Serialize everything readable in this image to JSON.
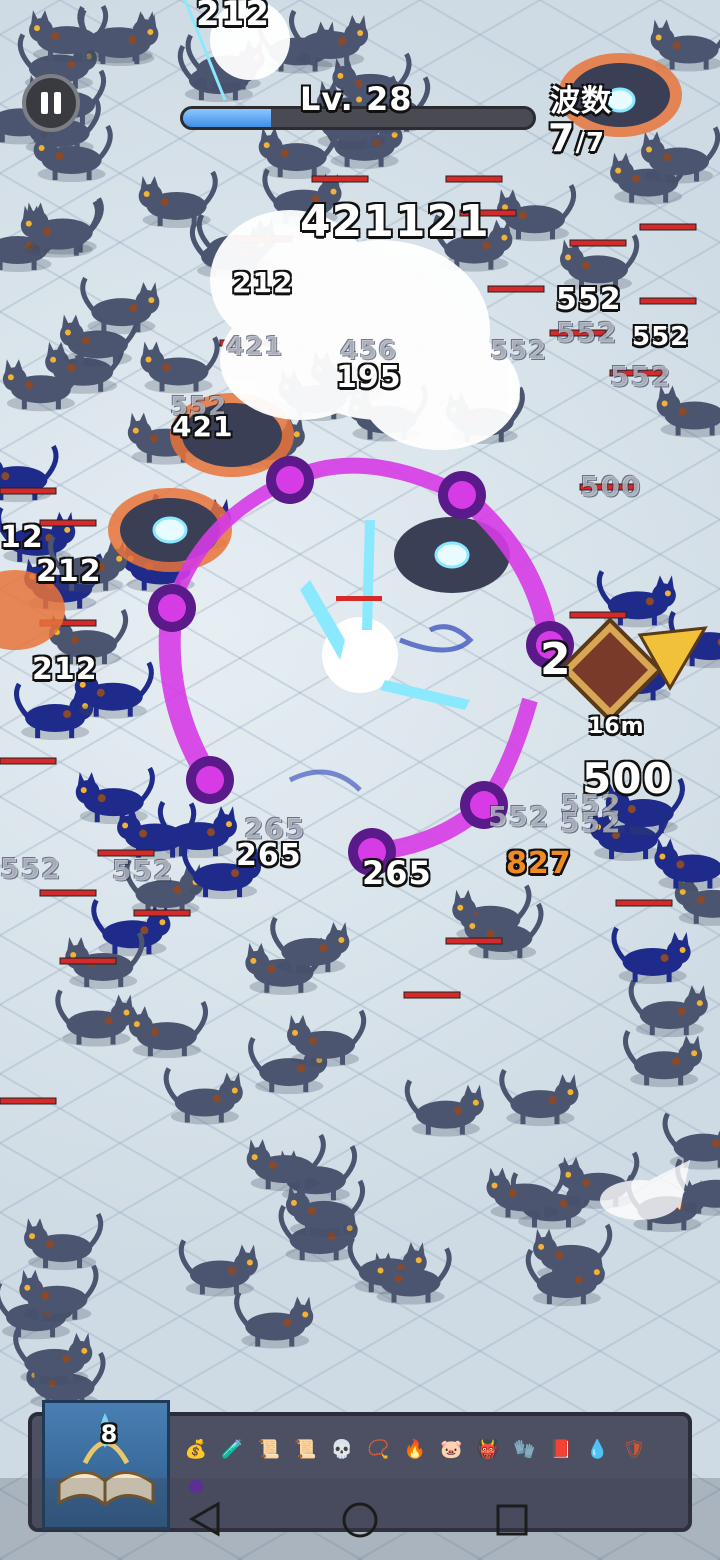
{
  "hud": {
    "level_label": "Lv. 28",
    "xp_progress": 0.25,
    "wave_title": "波数",
    "wave_current": "7",
    "wave_total": "/7",
    "target_distance": "16m"
  },
  "damage_numbers": [
    {
      "text": "212",
      "style": "normal",
      "size": 34
    },
    {
      "text": "421121",
      "style": "normal",
      "size": 44
    },
    {
      "text": "212",
      "style": "normal",
      "size": 28
    },
    {
      "text": "552",
      "style": "normal",
      "size": 30
    },
    {
      "text": "552",
      "style": "faded",
      "size": 28
    },
    {
      "text": "552",
      "style": "normal",
      "size": 26
    },
    {
      "text": "552",
      "style": "faded",
      "size": 26
    },
    {
      "text": "552",
      "style": "faded",
      "size": 28
    },
    {
      "text": "421",
      "style": "faded",
      "size": 26
    },
    {
      "text": "456",
      "style": "faded",
      "size": 26
    },
    {
      "text": "195",
      "style": "normal",
      "size": 30
    },
    {
      "text": "552",
      "style": "faded",
      "size": 26
    },
    {
      "text": "421",
      "style": "normal",
      "size": 28
    },
    {
      "text": "500",
      "style": "faded",
      "size": 28
    },
    {
      "text": "12",
      "style": "normal",
      "size": 30
    },
    {
      "text": "212",
      "style": "normal",
      "size": 30
    },
    {
      "text": "212",
      "style": "normal",
      "size": 30
    },
    {
      "text": "2",
      "style": "normal",
      "size": 44
    },
    {
      "text": "500",
      "style": "normal",
      "size": 42
    },
    {
      "text": "552",
      "style": "faded",
      "size": 28
    },
    {
      "text": "552",
      "style": "faded",
      "size": 28
    },
    {
      "text": "827",
      "style": "orange",
      "size": 30
    },
    {
      "text": "265",
      "style": "faded",
      "size": 28
    },
    {
      "text": "265",
      "style": "normal",
      "size": 30
    },
    {
      "text": "265",
      "style": "normal",
      "size": 32
    },
    {
      "text": "552",
      "style": "faded",
      "size": 28
    },
    {
      "text": "552",
      "style": "faded",
      "size": 28
    },
    {
      "text": "552",
      "style": "faded",
      "size": 28
    }
  ],
  "spellbook": {
    "count": "8"
  },
  "inventory": [
    {
      "name": "coin-pouch-icon",
      "glyph": "💰",
      "color": "#a0622d"
    },
    {
      "name": "potion-bag-icon",
      "glyph": "🧪",
      "color": "#c84848"
    },
    {
      "name": "scroll-icon",
      "glyph": "📜",
      "color": "#d8c8a8"
    },
    {
      "name": "scroll-icon",
      "glyph": "📜",
      "color": "#d8c8a8"
    },
    {
      "name": "skull-icon",
      "glyph": "💀",
      "color": "#e8e8e8"
    },
    {
      "name": "amulet-icon",
      "glyph": "📿",
      "color": "#c89a38"
    },
    {
      "name": "fire-crystal-icon",
      "glyph": "🔥",
      "color": "#e06a28"
    },
    {
      "name": "piggy-bank-icon",
      "glyph": "🐷",
      "color": "#f0a0b8"
    },
    {
      "name": "demon-mask-icon",
      "glyph": "👹",
      "color": "#d03048"
    },
    {
      "name": "gauntlet-icon",
      "glyph": "🧤",
      "color": "#9a9a9a"
    },
    {
      "name": "spellbook-purple-icon",
      "glyph": "📕",
      "color": "#8848c8"
    },
    {
      "name": "water-drop-icon",
      "glyph": "💧",
      "color": "#7aa8e8"
    },
    {
      "name": "shield-icon",
      "glyph": "🛡",
      "color": "#c85838"
    },
    {
      "name": "dark-orb-icon",
      "glyph": "●",
      "color": "#6a2aa8"
    }
  ],
  "colors": {
    "arcane": "#d63be6",
    "lightning": "#8be9ff",
    "shadow_cat": "#1f2b8a",
    "grey_cat": "#4b5570",
    "health_bar": "#d42a2a"
  }
}
